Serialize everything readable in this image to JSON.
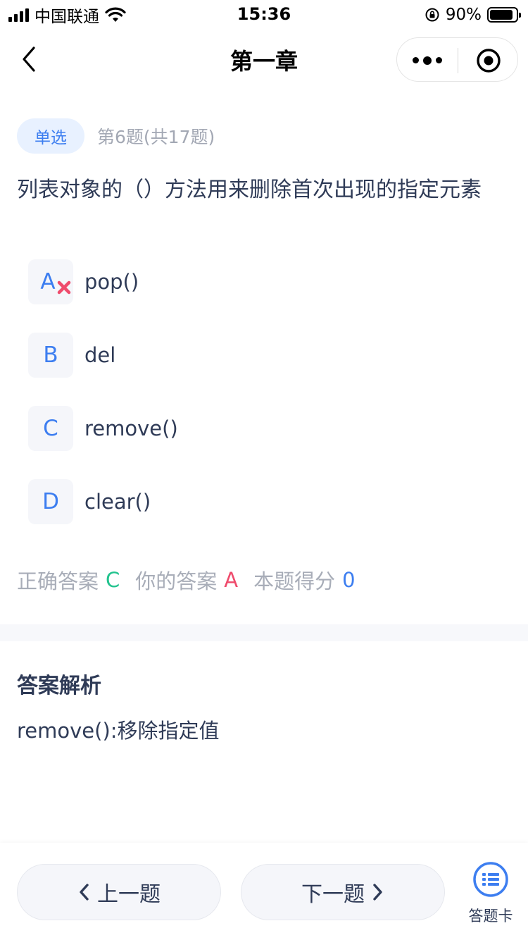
{
  "status_bar": {
    "carrier": "中国联通",
    "time": "15:36",
    "battery_percent": "90%",
    "battery_level": 0.9
  },
  "nav": {
    "title": "第一章"
  },
  "question": {
    "type_tag": "单选",
    "index_text": "第6题(共17题)",
    "text": "列表对象的（）方法用来删除首次出现的指定元素",
    "options": [
      {
        "letter": "A",
        "text": "pop()",
        "selected_wrong": true
      },
      {
        "letter": "B",
        "text": "del"
      },
      {
        "letter": "C",
        "text": "remove()"
      },
      {
        "letter": "D",
        "text": "clear()"
      }
    ]
  },
  "result": {
    "correct_label": "正确答案",
    "correct_value": "C",
    "yours_label": "你的答案",
    "yours_value": "A",
    "score_label": "本题得分",
    "score_value": "0"
  },
  "analysis": {
    "title": "答案解析",
    "text": "remove():移除指定值"
  },
  "bottom": {
    "prev_label": "上一题",
    "next_label": "下一题",
    "card_label": "答题卡"
  },
  "colors": {
    "accent": "#3d7ef0",
    "correct": "#22c38e",
    "wrong": "#ef4b6c",
    "muted": "#a8adb8",
    "text": "#2f3b57"
  }
}
